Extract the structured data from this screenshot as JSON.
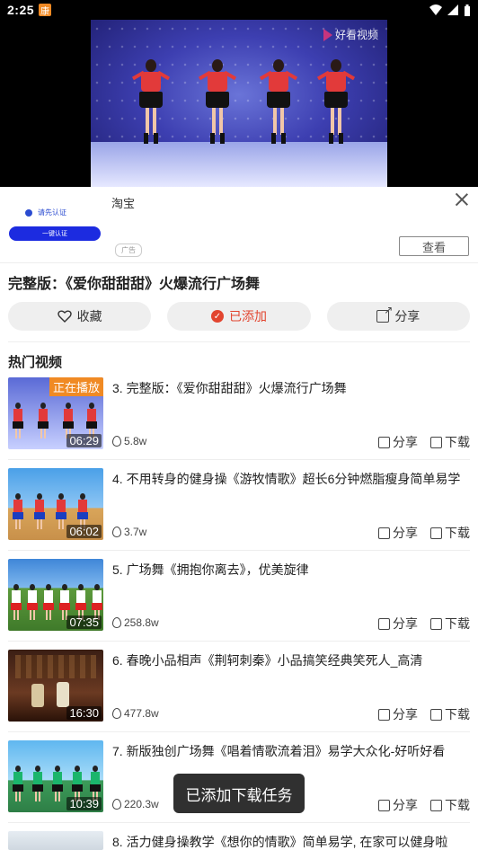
{
  "status": {
    "time": "2:25",
    "notif_glyph": "康"
  },
  "player": {
    "watermark": "好看视频"
  },
  "ad": {
    "thumb_line1": "请先认证",
    "thumb_button": "一键认证",
    "advertiser": "淘宝",
    "badge": "广告",
    "view_button": "查看"
  },
  "video_title": "完整版：《爱你甜甜甜》火爆流行广场舞",
  "actions": {
    "favorite": "收藏",
    "added": "已添加",
    "share": "分享"
  },
  "hot_section": {
    "label": "热门视频"
  },
  "videos": [
    {
      "title": "3. 完整版：《爱你甜甜甜》火爆流行广场舞",
      "duration": "06:29",
      "views": "5.8w",
      "playing": "正在播放",
      "share": "分享",
      "download": "下载"
    },
    {
      "title": "4. 不用转身的健身操《游牧情歌》超长6分钟燃脂瘦身简单易学",
      "duration": "06:02",
      "views": "3.7w",
      "share": "分享",
      "download": "下载"
    },
    {
      "title": "5. 广场舞《拥抱你离去》，优美旋律",
      "duration": "07:35",
      "views": "258.8w",
      "share": "分享",
      "download": "下载"
    },
    {
      "title": "6. 春晚小品相声《荆轲刺秦》小品搞笑经典笑死人_高清",
      "duration": "16:30",
      "views": "477.8w",
      "share": "分享",
      "download": "下载"
    },
    {
      "title": "7. 新版独创广场舞《唱着情歌流着泪》易学大众化-好听好看",
      "duration": "10:39",
      "views": "220.3w",
      "share": "分享",
      "download": "下载"
    },
    {
      "title": "8. 活力健身操教学《想你的情歌》简单易学, 在家可以健身啦"
    }
  ],
  "toast": "已添加下载任务",
  "colors": {
    "accent": "#e2452f",
    "playing_badge": "#f08a24"
  }
}
